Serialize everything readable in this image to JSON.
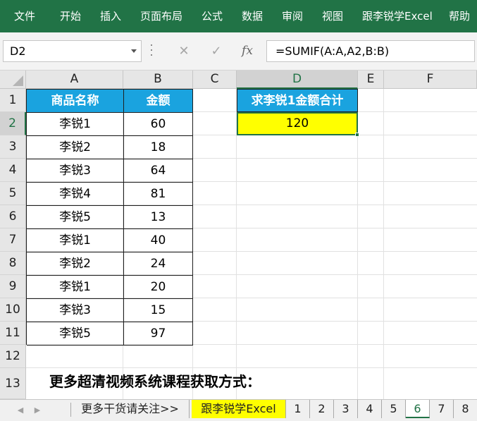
{
  "ribbon": {
    "tabs": [
      "文件",
      "开始",
      "插入",
      "页面布局",
      "公式",
      "数据",
      "审阅",
      "视图",
      "跟李锐学Excel",
      "帮助"
    ]
  },
  "formula_bar": {
    "name_box": "D2",
    "cancel_glyph": "✕",
    "enter_glyph": "✓",
    "fx_label": "fx",
    "formula": "=SUMIF(A:A,A2,B:B)"
  },
  "columns": [
    "A",
    "B",
    "C",
    "D",
    "E",
    "F"
  ],
  "rows": [
    "1",
    "2",
    "3",
    "4",
    "5",
    "6",
    "7",
    "8",
    "9",
    "10",
    "11",
    "12",
    "13"
  ],
  "table": {
    "headers": [
      "商品名称",
      "金额"
    ],
    "rows": [
      [
        "李锐1",
        "60"
      ],
      [
        "李锐2",
        "18"
      ],
      [
        "李锐3",
        "64"
      ],
      [
        "李锐4",
        "81"
      ],
      [
        "李锐5",
        "13"
      ],
      [
        "李锐1",
        "40"
      ],
      [
        "李锐2",
        "24"
      ],
      [
        "李锐1",
        "20"
      ],
      [
        "李锐3",
        "15"
      ],
      [
        "李锐5",
        "97"
      ]
    ]
  },
  "result": {
    "header": "求李锐1金额合计",
    "value": "120"
  },
  "footer_text": "更多超清视频系统课程获取方式：",
  "sheet_tabs": [
    "更多干货请关注>>",
    "跟李锐学Excel",
    "1",
    "2",
    "3",
    "4",
    "5",
    "6",
    "7",
    "8"
  ],
  "active_sheet": "6",
  "colors": {
    "ribbon_green": "#217346",
    "table_header_blue": "#1aa3df",
    "highlight_yellow": "#ffff00"
  }
}
